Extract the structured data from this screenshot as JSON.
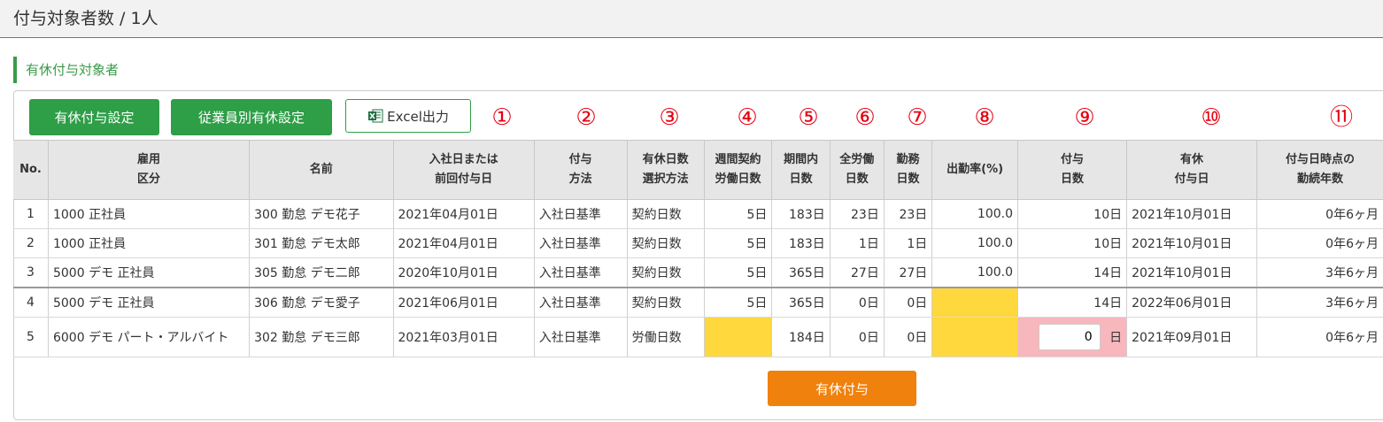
{
  "header": {
    "title": "付与対象者数 / 1人"
  },
  "section": {
    "title": "有休付与対象者"
  },
  "toolbar": {
    "grant_settings_label": "有休付与設定",
    "employee_settings_label": "従業員別有休設定",
    "excel_label": "Excel出力"
  },
  "column_markers": [
    "①",
    "②",
    "③",
    "④",
    "⑤",
    "⑥",
    "⑦",
    "⑧",
    "⑨",
    "⑩",
    "⑪"
  ],
  "table": {
    "headers": {
      "no": "No.",
      "employment_type": [
        "雇用",
        "区分"
      ],
      "name": "名前",
      "join_date": [
        "入社日または",
        "前回付与日"
      ],
      "grant_method": [
        "付与",
        "方法"
      ],
      "days_selection": [
        "有休日数",
        "選択方法"
      ],
      "weekly_days": [
        "週間契約",
        "労働日数"
      ],
      "period_days": [
        "期間内",
        "日数"
      ],
      "total_work_days": [
        "全労働",
        "日数"
      ],
      "attendance_days": [
        "勤務",
        "日数"
      ],
      "attendance_rate": "出勤率(%)",
      "grant_days": [
        "付与",
        "日数"
      ],
      "grant_date": [
        "有休",
        "付与日"
      ],
      "tenure": [
        "付与日時点の",
        "勤続年数"
      ]
    },
    "rows": [
      {
        "no": "1",
        "type": "1000 正社員",
        "name": "300 勤怠 デモ花子",
        "join": "2021年04月01日",
        "method": "入社日基準",
        "selection": "契約日数",
        "weekly": "5日",
        "period": "183日",
        "total": "23日",
        "attend": "23日",
        "rate": "100.0",
        "grant": "10日",
        "grant_date": "2021年10月01日",
        "tenure": "0年6ヶ月"
      },
      {
        "no": "2",
        "type": "1000 正社員",
        "name": "301 勤怠 デモ太郎",
        "join": "2021年04月01日",
        "method": "入社日基準",
        "selection": "契約日数",
        "weekly": "5日",
        "period": "183日",
        "total": "1日",
        "attend": "1日",
        "rate": "100.0",
        "grant": "10日",
        "grant_date": "2021年10月01日",
        "tenure": "0年6ヶ月"
      },
      {
        "no": "3",
        "type": "5000 デモ 正社員",
        "name": "305 勤怠 デモ二郎",
        "join": "2020年10月01日",
        "method": "入社日基準",
        "selection": "契約日数",
        "weekly": "5日",
        "period": "365日",
        "total": "27日",
        "attend": "27日",
        "rate": "100.0",
        "grant": "14日",
        "grant_date": "2021年10月01日",
        "tenure": "3年6ヶ月"
      },
      {
        "no": "4",
        "type": "5000 デモ 正社員",
        "name": "306 勤怠 デモ愛子",
        "join": "2021年06月01日",
        "method": "入社日基準",
        "selection": "契約日数",
        "weekly": "5日",
        "period": "365日",
        "total": "0日",
        "attend": "0日",
        "rate": "",
        "grant": "14日",
        "grant_date": "2022年06月01日",
        "tenure": "3年6ヶ月"
      },
      {
        "no": "5",
        "type": "6000 デモ パート・アルバイト",
        "name": "302 勤怠 デモ三郎",
        "join": "2021年03月01日",
        "method": "入社日基準",
        "selection": "労働日数",
        "weekly": "",
        "period": "184日",
        "total": "0日",
        "attend": "0日",
        "rate": "",
        "grant_input_value": "0",
        "grant_unit": "日",
        "grant_date": "2021年09月01日",
        "tenure": "0年6ヶ月"
      }
    ]
  },
  "footer": {
    "grant_button_label": "有休付与"
  },
  "colors": {
    "accent_green": "#2e9e47",
    "highlight_yellow": "#ffd83d",
    "input_pink": "#f8b6bd",
    "action_orange": "#f0810d",
    "marker_red": "#e60012"
  }
}
